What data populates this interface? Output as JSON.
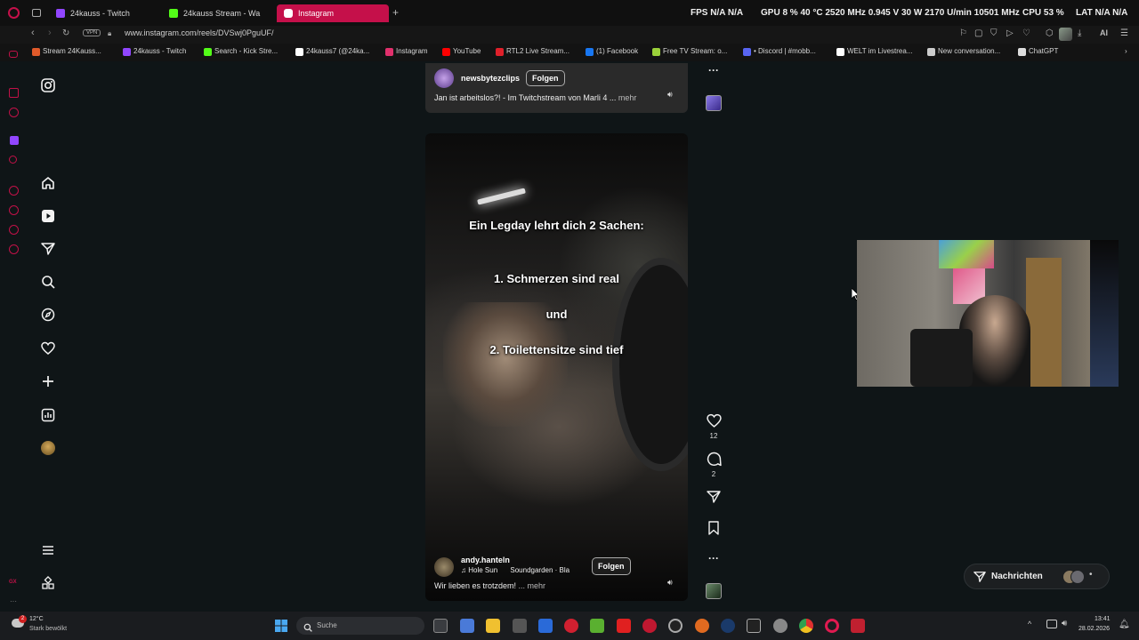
{
  "browser": {
    "tabs": [
      {
        "label": "24kauss - Twitch",
        "icon_color": "#9146ff",
        "active": false
      },
      {
        "label": "24kauss Stream - Wa",
        "icon_color": "#53fc18",
        "active": false
      },
      {
        "label": "Instagram",
        "icon_color": "#e1306c",
        "active": true
      }
    ],
    "new_tab_label": "+",
    "url": "www.instagram.com/reels/DVSwj0PguUF/",
    "vpn_label": "VPN",
    "stats": {
      "fps": "FPS  N/A  N/A",
      "gpu": "GPU  8 %  40 °C  2520 MHz  0.945 V  30 W  2170 U/min  10501 MHz",
      "cpu": "CPU  53 %",
      "lat": "LAT  N/A  N/A"
    },
    "ai_label": "AI",
    "bookmarks": [
      {
        "label": "Stream 24Kauss...",
        "color": "#e05a2a"
      },
      {
        "label": "24kauss - Twitch",
        "color": "#9146ff"
      },
      {
        "label": "Search - Kick Stre...",
        "color": "#53fc18"
      },
      {
        "label": "24kauss7 (@24ka...",
        "color": "#ffffff"
      },
      {
        "label": "Instagram",
        "color": "#e1306c"
      },
      {
        "label": "YouTube",
        "color": "#ff0000"
      },
      {
        "label": "RTL2 Live Stream...",
        "color": "#e0202a"
      },
      {
        "label": "(1) Facebook",
        "color": "#1877f2"
      },
      {
        "label": "Free TV Stream: o...",
        "color": "#9bd13a"
      },
      {
        "label": "• Discord | #mobb...",
        "color": "#5865f2"
      },
      {
        "label": "WELT im Livestrea...",
        "color": "#ffffff"
      },
      {
        "label": "New conversation...",
        "color": "#cccccc"
      },
      {
        "label": "ChatGPT",
        "color": "#dddddd"
      }
    ]
  },
  "reels": {
    "top_reel": {
      "handle": "newsbytezclips",
      "follow_label": "Folgen",
      "caption": "Jan ist arbeitslos?! - Im Twitchstream von Marli 4 ...",
      "more_label": "mehr"
    },
    "main_reel": {
      "overlay_lines": [
        "Ein Legday lehrt dich 2 Sachen:",
        "1. Schmerzen sind real",
        "und",
        "2. Toilettensitze sind tief"
      ],
      "handle": "andy.hanteln",
      "follow_label": "Folgen",
      "audio_title": "Hole Sun",
      "audio_artist": "Soundgarden · Bla",
      "caption": "Wir lieben es trotzdem!",
      "more_label": "... mehr",
      "likes": "12",
      "comments": "2"
    }
  },
  "messages": {
    "label": "Nachrichten"
  },
  "taskbar": {
    "weather_temp": "12°C",
    "weather_desc": "Stark bewölkt",
    "search_placeholder": "Suche",
    "time": "13:41",
    "date": "28.02.2026",
    "notification_count": "2"
  },
  "colors": {
    "accent": "#c5104a",
    "page_bg": "#0f1517"
  }
}
